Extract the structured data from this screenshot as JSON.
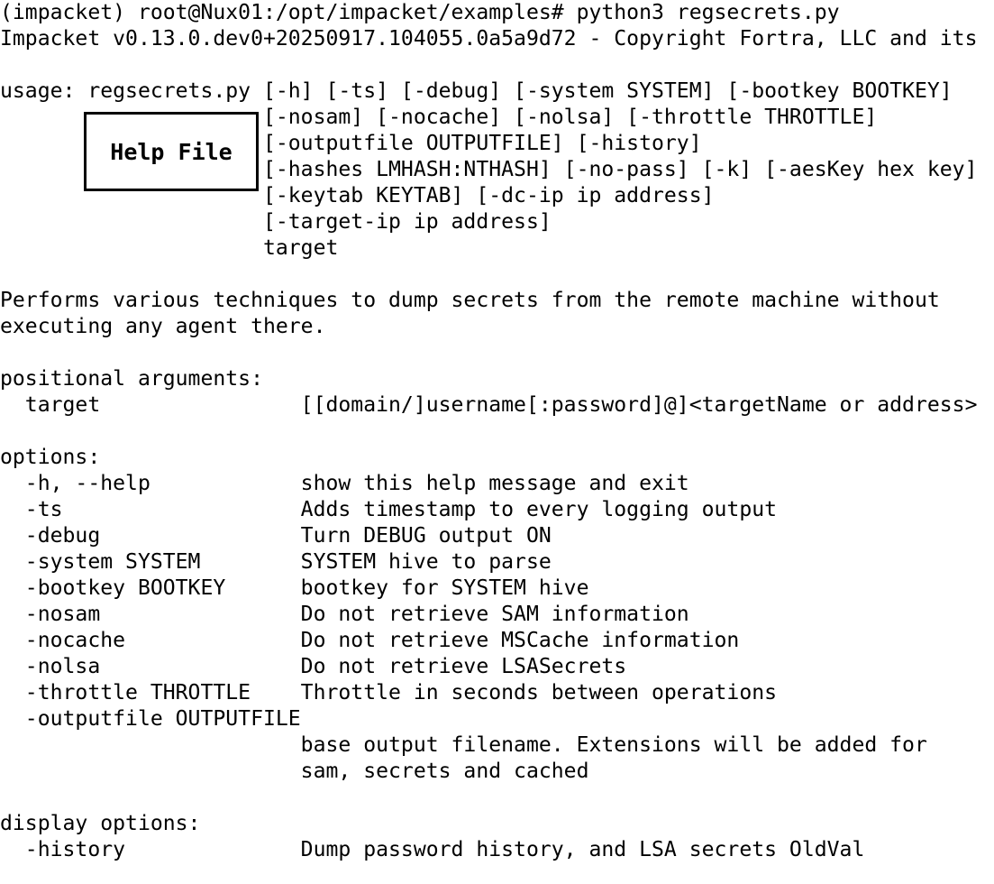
{
  "terminal": {
    "lines": [
      "(impacket) root@Nux01:/opt/impacket/examples# python3 regsecrets.py",
      "Impacket v0.13.0.dev0+20250917.104055.0a5a9d72 - Copyright Fortra, LLC and its",
      "",
      "usage: regsecrets.py [-h] [-ts] [-debug] [-system SYSTEM] [-bootkey BOOTKEY]",
      "                     [-nosam] [-nocache] [-nolsa] [-throttle THROTTLE]",
      "                     [-outputfile OUTPUTFILE] [-history]",
      "                     [-hashes LMHASH:NTHASH] [-no-pass] [-k] [-aesKey hex key]",
      "                     [-keytab KEYTAB] [-dc-ip ip address]",
      "                     [-target-ip ip address]",
      "                     target",
      "",
      "Performs various techniques to dump secrets from the remote machine without",
      "executing any agent there.",
      "",
      "positional arguments:",
      "  target                [[domain/]username[:password]@]<targetName or address>",
      "",
      "options:",
      "  -h, --help            show this help message and exit",
      "  -ts                   Adds timestamp to every logging output",
      "  -debug                Turn DEBUG output ON",
      "  -system SYSTEM        SYSTEM hive to parse",
      "  -bootkey BOOTKEY      bootkey for SYSTEM hive",
      "  -nosam                Do not retrieve SAM information",
      "  -nocache              Do not retrieve MSCache information",
      "  -nolsa                Do not retrieve LSASecrets",
      "  -throttle THROTTLE    Throttle in seconds between operations",
      "  -outputfile OUTPUTFILE",
      "                        base output filename. Extensions will be added for",
      "                        sam, secrets and cached",
      "",
      "display options:",
      "  -history              Dump password history, and LSA secrets OldVal",
      ""
    ]
  },
  "annotation": {
    "label": "Help File"
  }
}
